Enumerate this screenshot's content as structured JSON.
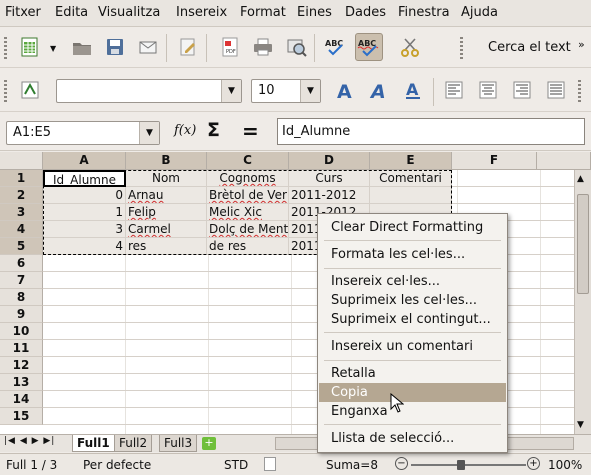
{
  "menu": [
    "Fitxer",
    "Edita",
    "Visualitza",
    "Insereix",
    "Format",
    "Eines",
    "Dades",
    "Finestra",
    "Ajuda"
  ],
  "toolbar": {
    "search_label": "Cerca el text",
    "font_size": "10"
  },
  "formula": {
    "name_box": "A1:E5",
    "fx_symbol": "f(x)",
    "sum_symbol": "Σ",
    "equals_symbol": "=",
    "content": "Id_Alumne"
  },
  "grid": {
    "columns": [
      "A",
      "B",
      "C",
      "D",
      "E",
      "F"
    ],
    "rows": [
      "1",
      "2",
      "3",
      "4",
      "5",
      "6",
      "7",
      "8",
      "9",
      "10",
      "11",
      "12",
      "13",
      "14",
      "15"
    ],
    "data": [
      [
        "Id_Alumne",
        "Nom",
        "Cognoms",
        "Curs",
        "Comentari"
      ],
      [
        "0",
        "Arnau",
        "Brètol de Ver",
        "2011-2012",
        ""
      ],
      [
        "1",
        "Felip",
        "Melic Xic",
        "2011-2012",
        ""
      ],
      [
        "3",
        "Carmel",
        "Dolç de Ment",
        "2011",
        ""
      ],
      [
        "4",
        "res",
        "de res",
        "2011",
        ""
      ]
    ]
  },
  "sheets": [
    "Full1",
    "Full2",
    "Full3"
  ],
  "status": {
    "page": "Full 1 / 3",
    "style": "Per defecte",
    "mode": "STD",
    "sum": "Suma=8",
    "zoom": "100%"
  },
  "context_menu": [
    "Clear Direct Formatting",
    "Formata les cel·les...",
    "Insereix cel·les...",
    "Suprimeix les cel·les...",
    "Suprimeix el contingut...",
    "Insereix un comentari",
    "Retalla",
    "Copia",
    "Enganxa",
    "Llista de selecció..."
  ]
}
